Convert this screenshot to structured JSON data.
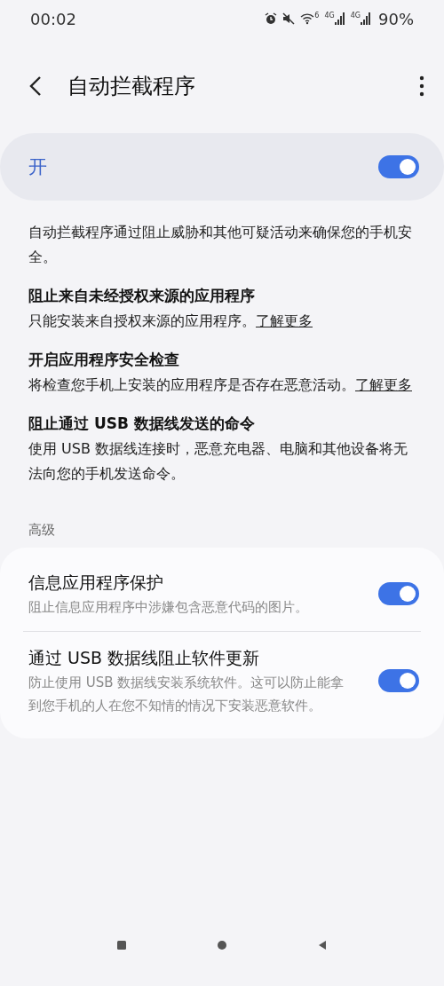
{
  "status_bar": {
    "time": "00:02",
    "wifi_label": "6",
    "signals": [
      {
        "label": "4G"
      },
      {
        "label": "4G"
      }
    ],
    "battery": "90%"
  },
  "header": {
    "title": "自动拦截程序"
  },
  "master": {
    "label": "开",
    "on": true
  },
  "description": "自动拦截程序通过阻止威胁和其他可疑活动来确保您的手机安全。",
  "features": [
    {
      "title": "阻止来自未经授权来源的应用程序",
      "text": "只能安装来自授权来源的应用程序。",
      "link": "了解更多"
    },
    {
      "title": "开启应用程序安全检查",
      "text": "将检查您手机上安装的应用程序是否存在恶意活动。",
      "link": "了解更多"
    },
    {
      "title": "阻止通过 USB 数据线发送的命令",
      "text": "使用 USB 数据线连接时，恶意充电器、电脑和其他设备将无法向您的手机发送命令。"
    }
  ],
  "advanced": {
    "heading": "高级",
    "items": [
      {
        "title": "信息应用程序保护",
        "subtitle": "阻止信息应用程序中涉嫌包含恶意代码的图片。",
        "on": true
      },
      {
        "title": "通过 USB 数据线阻止软件更新",
        "subtitle": "防止使用 USB 数据线安装系统软件。这可以防止能拿到您手机的人在您不知情的情况下安装恶意软件。",
        "on": true
      }
    ]
  }
}
